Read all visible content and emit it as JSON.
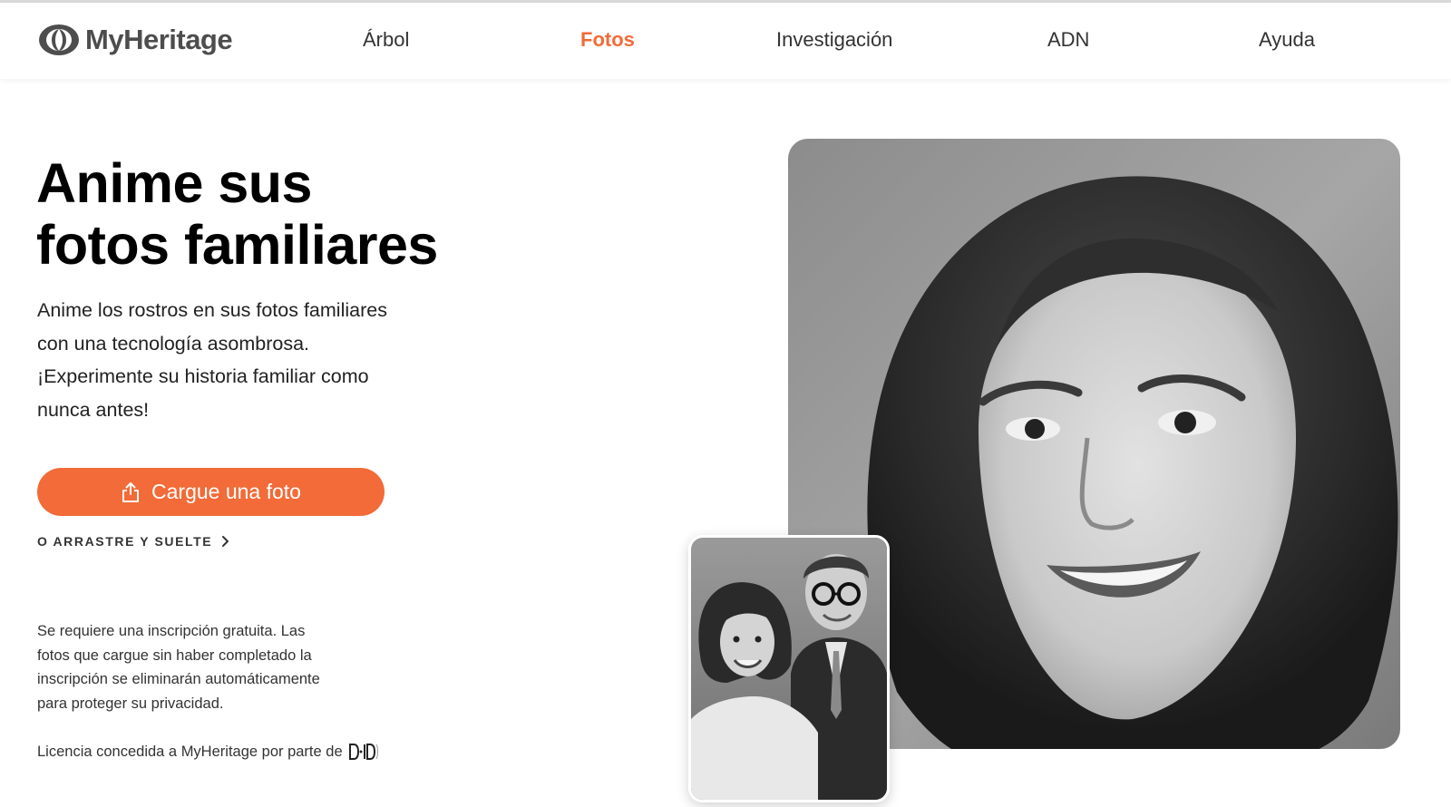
{
  "brand": {
    "name": "MyHeritage",
    "accent_color": "#f26b38"
  },
  "nav": {
    "items": [
      {
        "label": "Árbol",
        "active": false
      },
      {
        "label": "Fotos",
        "active": true
      },
      {
        "label": "Investigación",
        "active": false
      },
      {
        "label": "ADN",
        "active": false
      },
      {
        "label": "Ayuda",
        "active": false
      }
    ]
  },
  "hero": {
    "title_line1": "Anime sus",
    "title_line2": "fotos familiares",
    "description_line1": "Anime los rostros en sus fotos familiares",
    "description_line2": "con una tecnología asombrosa.",
    "description_line3": "¡Experimente su historia familiar como",
    "description_line4": "nunca antes!"
  },
  "upload": {
    "button_label": "Cargue una foto",
    "button_icon": "upload-icon",
    "drag_drop_label": "O ARRASTRE Y SUELTE"
  },
  "disclaimer": {
    "line1": "Se requiere una inscripción gratuita. Las",
    "line2": "fotos que cargue sin haber completado la",
    "line3": "inscripción se eliminarán automáticamente",
    "line4": "para proteger su privacidad."
  },
  "license": {
    "text": "Licencia concedida a MyHeritage por parte de",
    "partner_logo": "D-ID"
  },
  "images": {
    "main_photo": "black-and-white portrait of smiling woman",
    "small_photo": "black-and-white portrait of couple"
  }
}
